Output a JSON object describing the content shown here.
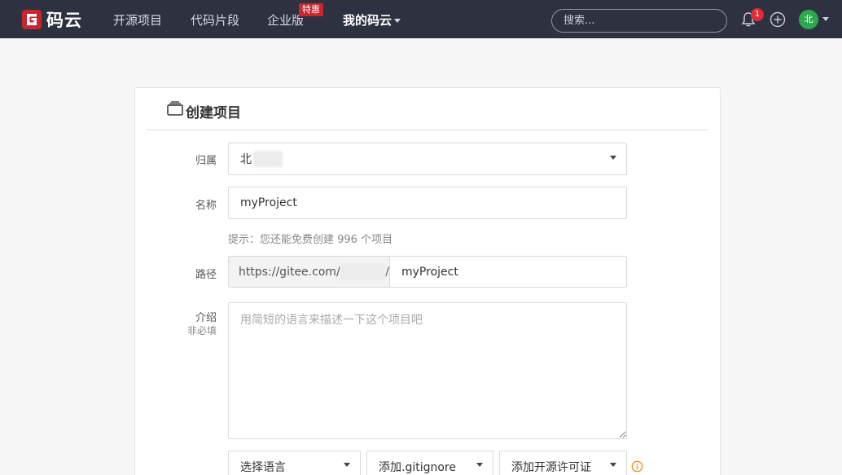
{
  "navbar": {
    "logo_text": "码云",
    "items": [
      "开源项目",
      "代码片段",
      "企业版",
      "我的码云"
    ],
    "promo_badge": "特惠",
    "search_placeholder": "搜索...",
    "notification_count": "1",
    "avatar_text": "北",
    "brand_color": "#c8252d",
    "bg_color": "#2d3140"
  },
  "form": {
    "title": "创建项目",
    "owner": {
      "label": "归属",
      "value": "北"
    },
    "name": {
      "label": "名称",
      "value": "myProject"
    },
    "hint": "提示：您还能免费创建 996 个项目",
    "path": {
      "label": "路径",
      "prefix": "https://gitee.com/",
      "prefix_suffix": "/",
      "value": "myProject"
    },
    "intro": {
      "label": "介绍",
      "sublabel": "非必填",
      "placeholder": "用简短的语言来描述一下这个项目吧"
    },
    "selects": {
      "language": "选择语言",
      "gitignore": "添加.gitignore",
      "license": "添加开源许可证"
    }
  }
}
